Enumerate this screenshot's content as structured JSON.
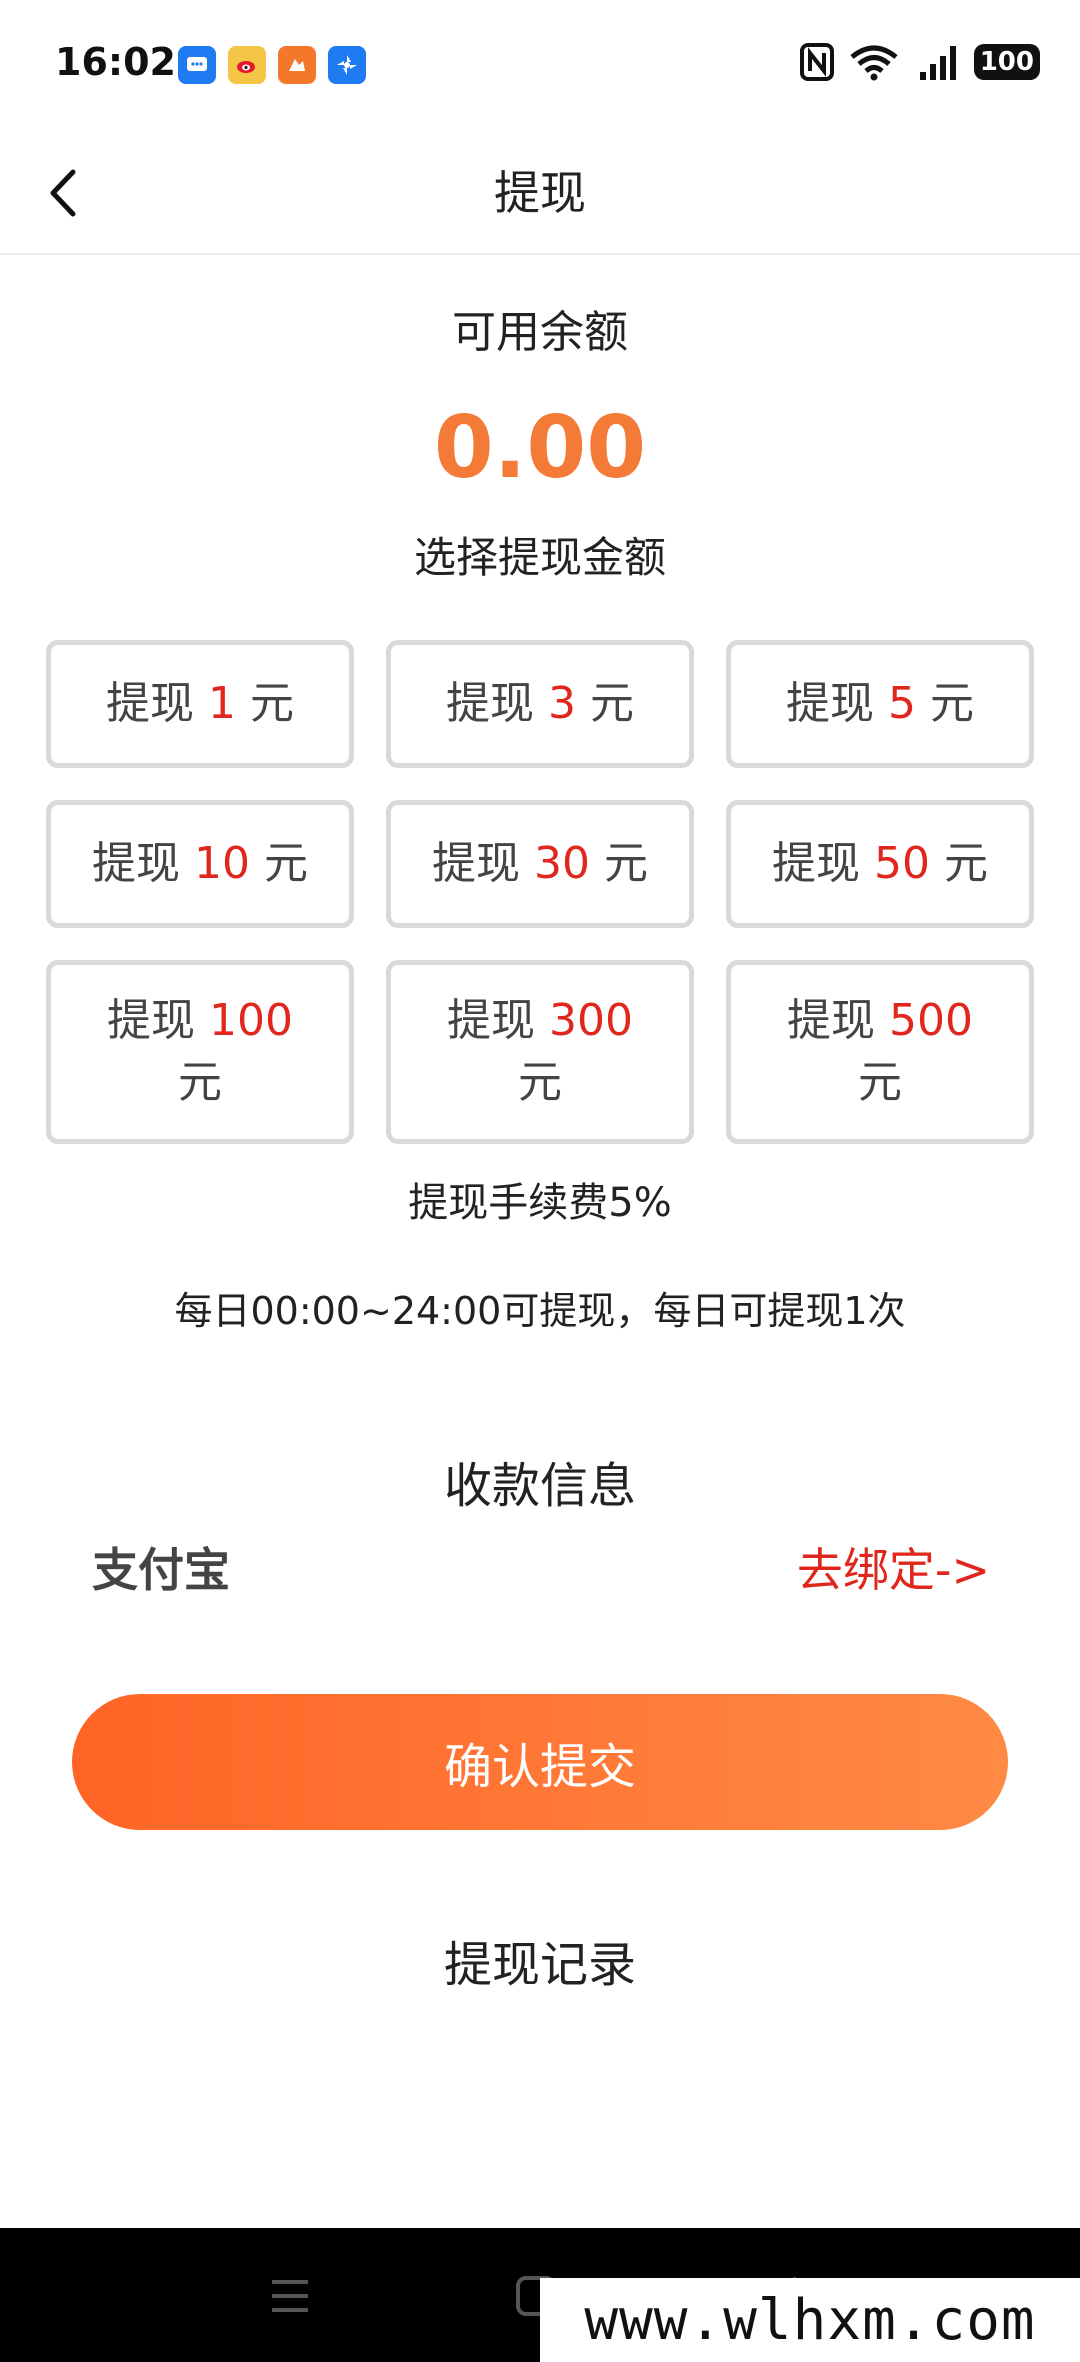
{
  "status": {
    "time": "16:02",
    "battery": "100",
    "apps": [
      "chat-app-icon",
      "weibo-icon",
      "game-app-icon",
      "pinwheel-app-icon"
    ]
  },
  "header": {
    "title": "提现"
  },
  "balance": {
    "label": "可用余额",
    "value": "0.00"
  },
  "choose_label": "选择提现金额",
  "options": [
    {
      "prefix": "提现",
      "amount": "1",
      "suffix": "元"
    },
    {
      "prefix": "提现",
      "amount": "3",
      "suffix": "元"
    },
    {
      "prefix": "提现",
      "amount": "5",
      "suffix": "元"
    },
    {
      "prefix": "提现",
      "amount": "10",
      "suffix": "元"
    },
    {
      "prefix": "提现",
      "amount": "30",
      "suffix": "元"
    },
    {
      "prefix": "提现",
      "amount": "50",
      "suffix": "元"
    },
    {
      "prefix": "提现",
      "amount": "100",
      "suffix": "元"
    },
    {
      "prefix": "提现",
      "amount": "300",
      "suffix": "元"
    },
    {
      "prefix": "提现",
      "amount": "500",
      "suffix": "元"
    }
  ],
  "fee": "提现手续费5%",
  "time_rule": "每日00:00~24:00可提现，每日可提现1次",
  "payee": {
    "title": "收款信息",
    "method": "支付宝",
    "bind_link": "去绑定->"
  },
  "submit_label": "确认提交",
  "records_label": "提现记录",
  "watermark": "www.wlhxm.com",
  "colors": {
    "accent": "#f47a38",
    "amount_red": "#e0261d",
    "button_start": "#ff6426",
    "button_end": "#ff8a45"
  }
}
